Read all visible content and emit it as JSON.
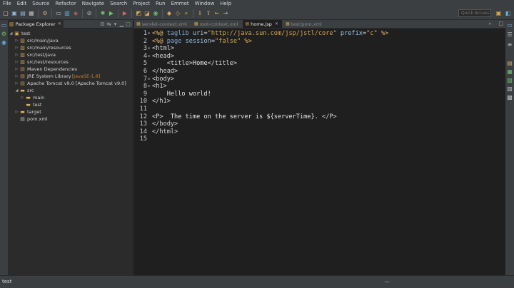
{
  "menubar": [
    "File",
    "Edit",
    "Source",
    "Refactor",
    "Navigate",
    "Search",
    "Project",
    "Run",
    "Emmet",
    "Window",
    "Help"
  ],
  "toolbar": {
    "icons": [
      "new-icon",
      "save-icon",
      "save-all-icon",
      "print-icon",
      "separator",
      "build-icon",
      "separator",
      "terminal-icon",
      "server-icon",
      "coverage-icon",
      "separator",
      "skip-breakpoints-icon",
      "separator",
      "debug-icon",
      "run-icon",
      "separator",
      "external-tools-icon",
      "separator",
      "new-java-project-icon",
      "new-package-icon",
      "new-class-icon",
      "separator",
      "open-type-icon",
      "open-task-icon",
      "search-icon",
      "separator",
      "prev-annotation-icon",
      "next-annotation-icon",
      "back-icon",
      "forward-icon"
    ],
    "quick_access_placeholder": "Quick Access"
  },
  "package_explorer": {
    "title": "Package Explorer",
    "tree": [
      {
        "label": "test",
        "icon": "project-icon",
        "depth": 0,
        "expanded": true
      },
      {
        "label": "src/main/java",
        "icon": "source-folder-icon",
        "depth": 1,
        "expanded": false
      },
      {
        "label": "src/main/resources",
        "icon": "source-folder-icon",
        "depth": 1,
        "expanded": false
      },
      {
        "label": "src/test/java",
        "icon": "source-folder-icon",
        "depth": 1,
        "expanded": false
      },
      {
        "label": "src/test/resources",
        "icon": "source-folder-icon",
        "depth": 1,
        "expanded": false
      },
      {
        "label": "Maven Dependencies",
        "icon": "library-icon",
        "depth": 1,
        "expanded": false
      },
      {
        "label": "JRE System Library",
        "extra": "[JavaSE-1.8]",
        "icon": "library-icon",
        "depth": 1,
        "expanded": false
      },
      {
        "label": "Apache Tomcat v9.0 [Apache Tomcat v9.0]",
        "icon": "library-icon",
        "depth": 1,
        "expanded": false
      },
      {
        "label": "src",
        "icon": "folder-icon",
        "depth": 1,
        "expanded": true
      },
      {
        "label": "main",
        "icon": "folder-icon",
        "depth": 2,
        "expanded": false
      },
      {
        "label": "test",
        "icon": "folder-icon",
        "depth": 2,
        "expanded": null
      },
      {
        "label": "target",
        "icon": "folder-icon",
        "depth": 1,
        "expanded": false
      },
      {
        "label": "pom.xml",
        "icon": "xml-file-icon",
        "depth": 1,
        "expanded": null
      }
    ]
  },
  "editor": {
    "tabs": [
      {
        "label": "servlet-context.xml",
        "active": false
      },
      {
        "label": "root-context.xml",
        "active": false
      },
      {
        "label": "home.jsp",
        "active": true
      },
      {
        "label": "test/pom.xml",
        "active": false
      }
    ],
    "lines": [
      {
        "n": "1",
        "fold": "⊖",
        "tokens": [
          [
            "dir",
            "<%@ "
          ],
          [
            "dirk",
            "taglib"
          ],
          [
            "attr",
            " uri"
          ],
          [
            "tag",
            "="
          ],
          [
            "val",
            "\"http://java.sun.com/jsp/jstl/core\""
          ],
          [
            "attr",
            " prefix"
          ],
          [
            "tag",
            "="
          ],
          [
            "val",
            "\"c\""
          ],
          [
            "dir",
            " %>"
          ]
        ]
      },
      {
        "n": "2",
        "fold": "",
        "tokens": [
          [
            "dir",
            "<%@ "
          ],
          [
            "dirk",
            "page"
          ],
          [
            "attr",
            " session"
          ],
          [
            "tag",
            "="
          ],
          [
            "val",
            "\"false\""
          ],
          [
            "dir",
            " %>"
          ]
        ]
      },
      {
        "n": "3",
        "fold": "⊖",
        "tokens": [
          [
            "tag",
            "<html>"
          ]
        ]
      },
      {
        "n": "4",
        "fold": "⊖",
        "tokens": [
          [
            "tag",
            "<head>"
          ]
        ]
      },
      {
        "n": "5",
        "fold": "",
        "tokens": [
          [
            "text",
            "    "
          ],
          [
            "tag",
            "<title>"
          ],
          [
            "text",
            "Home"
          ],
          [
            "tag",
            "</title>"
          ]
        ]
      },
      {
        "n": "6",
        "fold": "",
        "tokens": [
          [
            "tag",
            "</head>"
          ]
        ]
      },
      {
        "n": "7",
        "fold": "⊖",
        "tokens": [
          [
            "tag",
            "<body>"
          ]
        ]
      },
      {
        "n": "8",
        "fold": "⊖",
        "tokens": [
          [
            "tag",
            "<h1>"
          ]
        ]
      },
      {
        "n": "9",
        "fold": "",
        "tokens": [
          [
            "text",
            "    Hello world!"
          ]
        ]
      },
      {
        "n": "10",
        "fold": "",
        "tokens": [
          [
            "tag",
            "</h1>"
          ]
        ]
      },
      {
        "n": "11",
        "fold": "",
        "tokens": []
      },
      {
        "n": "12",
        "fold": "",
        "tokens": [
          [
            "tag",
            "<P>"
          ],
          [
            "text",
            "  The time on the server is ${serverTime}. "
          ],
          [
            "tag",
            "</P>"
          ]
        ]
      },
      {
        "n": "13",
        "fold": "",
        "tokens": [
          [
            "tag",
            "</body>"
          ]
        ]
      },
      {
        "n": "14",
        "fold": "",
        "tokens": [
          [
            "tag",
            "</html>"
          ]
        ]
      },
      {
        "n": "15",
        "fold": "",
        "tokens": []
      }
    ]
  },
  "statusbar": {
    "text": "test"
  },
  "colors": {
    "background": "#2b2b2b",
    "editor_background": "#1f1f1f",
    "chrome": "#3c3f41",
    "attribute_value": "#d7a84a",
    "directive": "#e9b86b",
    "folder": "#dfb15a"
  }
}
